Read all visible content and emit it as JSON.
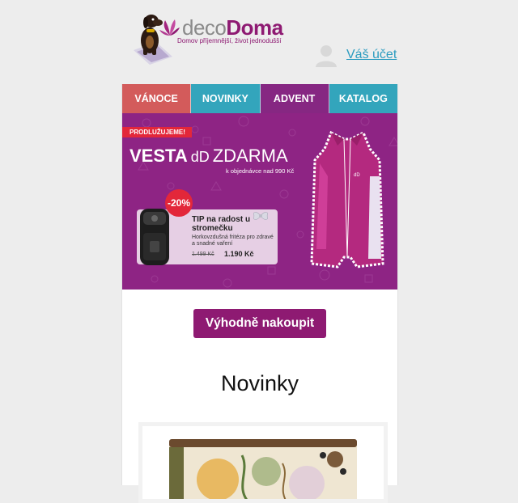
{
  "brand": {
    "name_part1": "deco",
    "name_part2": "Doma",
    "tagline": "Domov příjemnější, život jednodušší"
  },
  "account": {
    "link_label": "Váš účet"
  },
  "nav": {
    "items": [
      {
        "label": "VÁNOCE",
        "color": "#d35b5b"
      },
      {
        "label": "NOVINKY",
        "color": "#33a5bc"
      },
      {
        "label": "ADVENT",
        "color": "#862782"
      },
      {
        "label": "KATALOG",
        "color": "#33a5bc"
      }
    ]
  },
  "banner": {
    "ribbon": "PRODLUŽUJEME!",
    "title_bold": "VESTA",
    "title_logo": "dD",
    "title_rest": "ZDARMA",
    "subtitle": "k objednávce nad 990 Kč",
    "discount": "-20%",
    "promo_title": "TIP na radost u stromečku",
    "promo_desc": "Horkovzdušná fritéza pro zdravé a snadné vaření",
    "price_old": "1.499 Kč",
    "price_new": "1.190 Kč"
  },
  "cta": {
    "label": "Výhodně nakoupit"
  },
  "section": {
    "title": "Novinky"
  },
  "colors": {
    "brand": "#8e1a72",
    "banner_bg": "#8e2484",
    "link": "#2a9bbf"
  }
}
